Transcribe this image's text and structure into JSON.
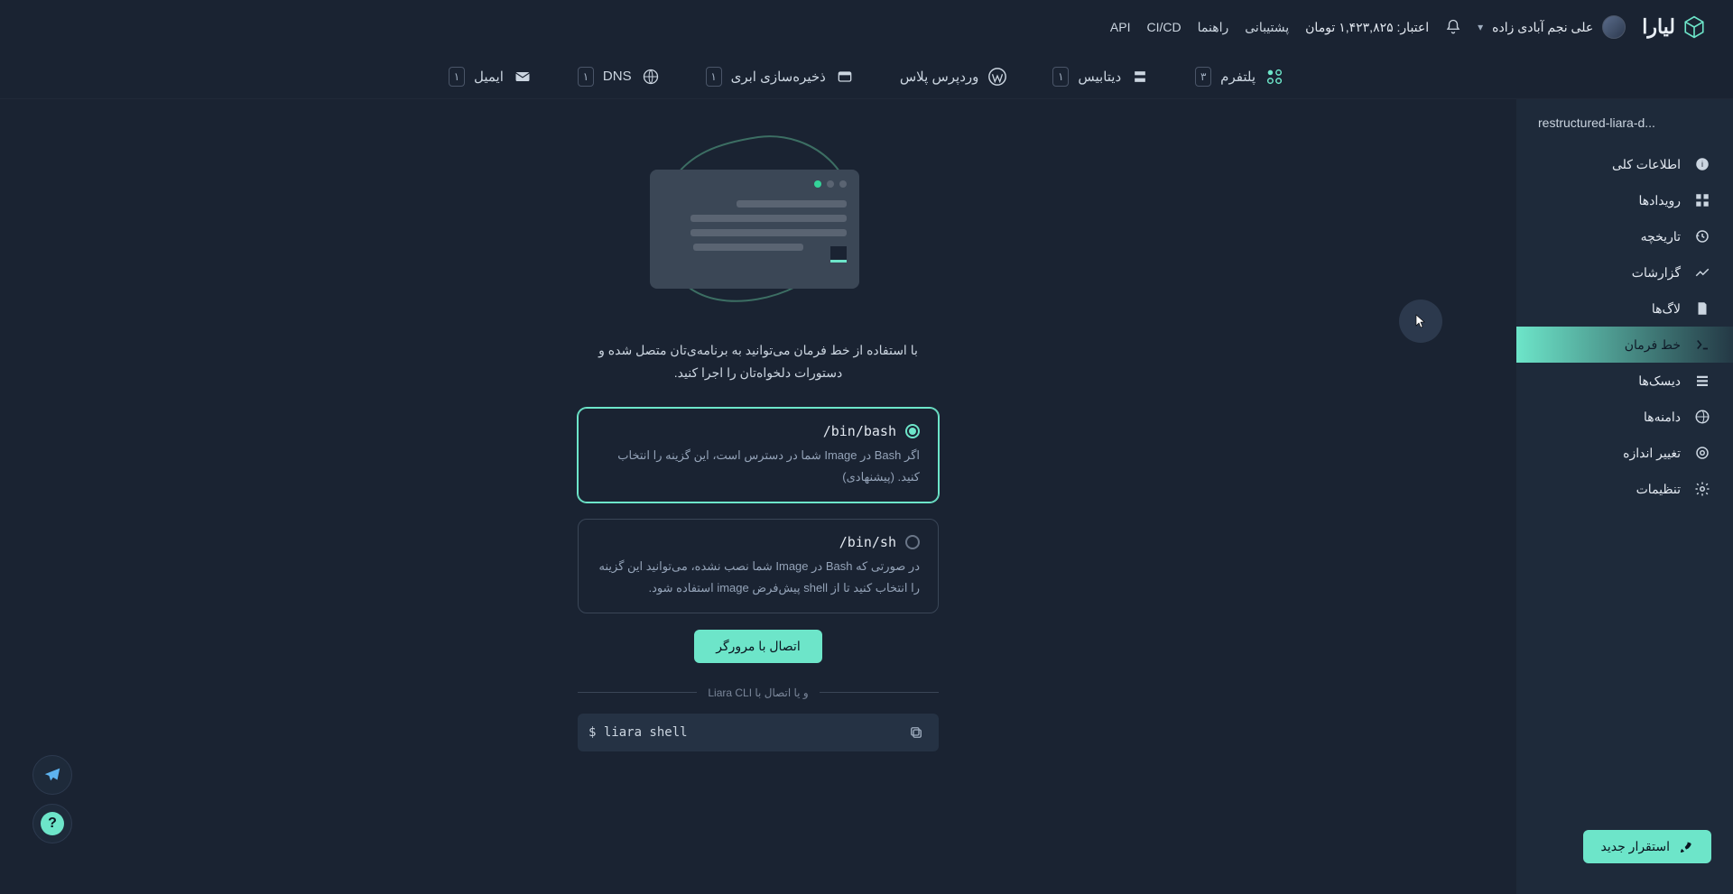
{
  "brand": "لیارا",
  "user": {
    "name": "علی نجم آبادی زاده",
    "credit": "اعتبار: ۱,۴۲۳,۸۲۵ تومان"
  },
  "topnav": {
    "support": "پشتیبانی",
    "guide": "راهنما",
    "cicd": "CI/CD",
    "api": "API"
  },
  "tabs": {
    "platform": {
      "label": "پلتفرم",
      "badge": "۳"
    },
    "database": {
      "label": "دیتابیس",
      "badge": "۱"
    },
    "wordpress": {
      "label": "وردپرس پلاس"
    },
    "storage": {
      "label": "ذخیره‌سازی ابری",
      "badge": "۱"
    },
    "dns": {
      "label": "DNS",
      "badge": "۱"
    },
    "email": {
      "label": "ایمیل",
      "badge": "۱"
    }
  },
  "sidebar": {
    "appname": "restructured-liara-d...",
    "overview": "اطلاعات کلی",
    "events": "رویدادها",
    "history": "تاریخچه",
    "reports": "گزارشات",
    "logs": "لاگ‌ها",
    "shell": "خط فرمان",
    "disks": "دیسک‌ها",
    "domains": "دامنه‌ها",
    "resize": "تغییر اندازه",
    "settings": "تنظیمات",
    "deploy": "استقرار جدید"
  },
  "shell_page": {
    "intro": "با استفاده از خط فرمان می‌توانید به برنامه‌ی‌تان متصل شده و دستورات دلخواه‌تان را اجرا کنید.",
    "bash": {
      "title": "/bin/bash",
      "desc": "اگر Bash در Image شما در دسترس است، این گزینه را انتخاب کنید. (پیشنهادی)"
    },
    "sh": {
      "title": "/bin/sh",
      "desc": "در صورتی که Bash در Image شما نصب نشده، می‌توانید این گزینه را انتخاب کنید تا از shell پیش‌فرض image استفاده شود."
    },
    "connect_browser": "اتصال با مرورگر",
    "cli_separator": "و یا اتصال با Liara CLI",
    "command": "$ liara shell"
  }
}
